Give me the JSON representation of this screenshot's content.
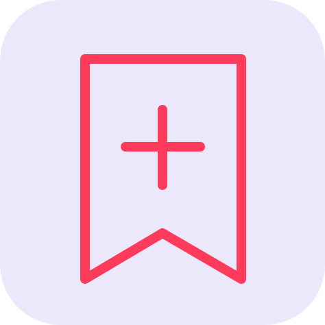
{
  "icon": {
    "name": "bookmark-add-icon",
    "background_color": "#ECE8FC",
    "stroke_color": "#FF3B5C"
  }
}
